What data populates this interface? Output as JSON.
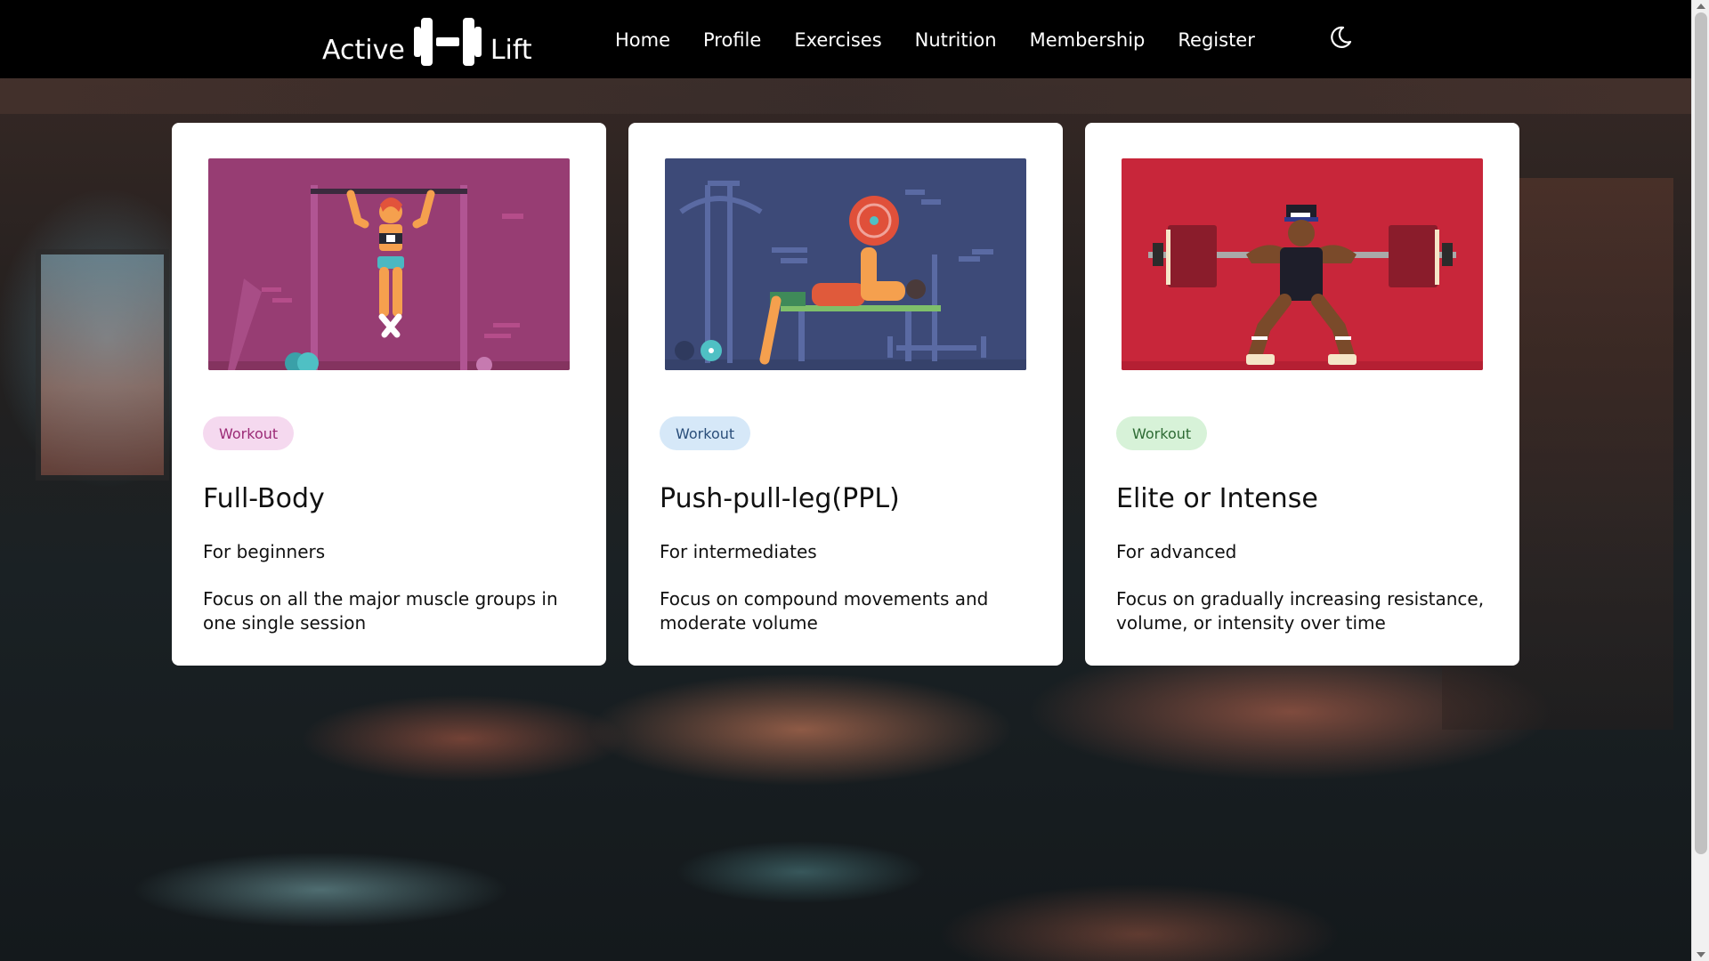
{
  "app": {
    "brand_left": "Active",
    "brand_right": "Lift"
  },
  "nav": {
    "items": [
      {
        "label": "Home"
      },
      {
        "label": "Profile"
      },
      {
        "label": "Exercises"
      },
      {
        "label": "Nutrition"
      },
      {
        "label": "Membership"
      },
      {
        "label": "Register"
      }
    ],
    "theme_toggle_icon": "moon-icon"
  },
  "cards": [
    {
      "illustration": "pull-up-illustration",
      "tag": "Workout",
      "tag_bg": "#f5d9ef",
      "tag_color": "#9b2a76",
      "title": "Full-Body",
      "level": "For beginners",
      "description": "Focus on all the major muscle groups in one single session"
    },
    {
      "illustration": "bench-press-illustration",
      "tag": "Workout",
      "tag_bg": "#d6e8f8",
      "tag_color": "#2a4e7a",
      "title": "Push-pull-leg(PPL)",
      "level": "For intermediates",
      "description": "Focus on compound movements and moderate volume"
    },
    {
      "illustration": "squat-illustration",
      "tag": "Workout",
      "tag_bg": "#d7f2d8",
      "tag_color": "#2e6b34",
      "title": "Elite or Intense",
      "level": "For advanced",
      "description": "Focus on gradually increasing resistance, volume, or intensity over time"
    }
  ]
}
